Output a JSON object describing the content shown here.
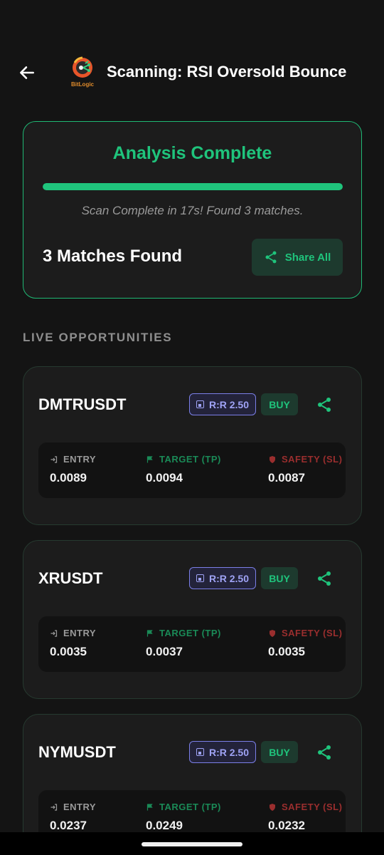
{
  "header": {
    "title": "Scanning: RSI Oversold Bounce",
    "logo_text": "BitLogic",
    "back_icon": "arrow-left-icon"
  },
  "status": {
    "title": "Analysis Complete",
    "progress_fraction": 1.0,
    "message": "Scan Complete in 17s! Found 3 matches.",
    "matches_label": "3 Matches Found",
    "share_all_label": "Share All"
  },
  "section": {
    "label": "LIVE OPPORTUNITIES"
  },
  "labels": {
    "entry": "ENTRY",
    "target": "TARGET (TP)",
    "safety": "SAFETY (SL)"
  },
  "opportunities": [
    {
      "symbol": "DMTRUSDT",
      "rr": "R:R 2.50",
      "side": "BUY",
      "entry": "0.0089",
      "target": "0.0094",
      "safety": "0.0087"
    },
    {
      "symbol": "XRUSDT",
      "rr": "R:R 2.50",
      "side": "BUY",
      "entry": "0.0035",
      "target": "0.0037",
      "safety": "0.0035"
    },
    {
      "symbol": "NYMUSDT",
      "rr": "R:R 2.50",
      "side": "BUY",
      "entry": "0.0237",
      "target": "0.0249",
      "safety": "0.0232"
    }
  ],
  "colors": {
    "accent_green": "#1fc47c",
    "rr_purple": "#9fa3f5",
    "safety_red": "#9a2e2e",
    "background": "#141414"
  }
}
